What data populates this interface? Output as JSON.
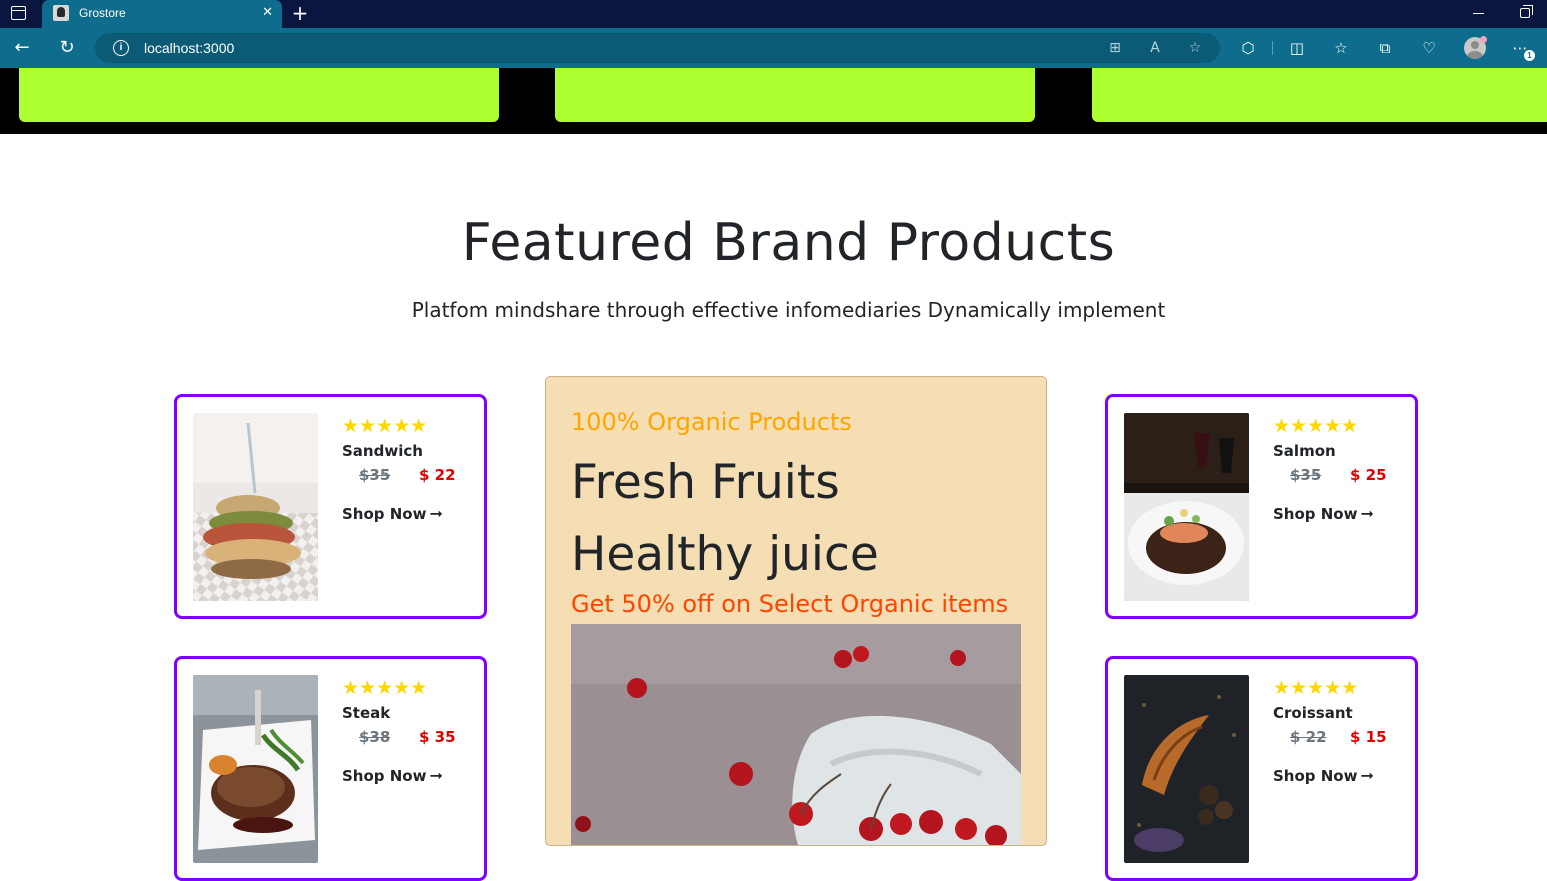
{
  "browser": {
    "tab_title": "Grostore",
    "tab_close": "✕",
    "new_tab": "+",
    "url": "localhost:3000",
    "info_glyph": "i",
    "notification_count": "1"
  },
  "section": {
    "title": "Featured Brand Products",
    "subtitle": "Platfom mindshare through effective infomediaries Dynamically implement"
  },
  "products": [
    {
      "name": "Sandwich",
      "rating_stars": "★★★★★",
      "rating": 5,
      "old_price": "$35",
      "new_price": "$ 22",
      "cta": "Shop Now",
      "image": "sandwich-photo"
    },
    {
      "name": "Steak",
      "rating_stars": "★★★★★",
      "rating": 5,
      "old_price": "$38",
      "new_price": "$ 35",
      "cta": "Shop Now",
      "image": "steak-photo"
    },
    {
      "name": "Salmon",
      "rating_stars": "★★★★★",
      "rating": 5,
      "old_price": "$35",
      "new_price": "$ 25",
      "cta": "Shop Now",
      "image": "salmon-photo"
    },
    {
      "name": "Croissant",
      "rating_stars": "★★★★★",
      "rating": 5,
      "old_price": "$ 22",
      "new_price": "$ 15",
      "cta": "Shop Now",
      "image": "croissant-photo"
    }
  ],
  "promo": {
    "kicker": "100% Organic Products",
    "title": "Fresh Fruits Healthy juice",
    "offer": "Get 50% off on Select Organic items",
    "image": "cherries-photo"
  },
  "colors": {
    "chrome_dark": "#0a1640",
    "chrome_teal": "#0e6d8c",
    "band_card": "#adff2f",
    "card_border": "#7f00ff",
    "star": "#ffd700",
    "price_red": "#e00000",
    "promo_bg": "#f5deb3",
    "kicker_orange": "#ffa500",
    "offer_orange": "#ff4500"
  },
  "icons": {
    "arrow": "➞"
  }
}
